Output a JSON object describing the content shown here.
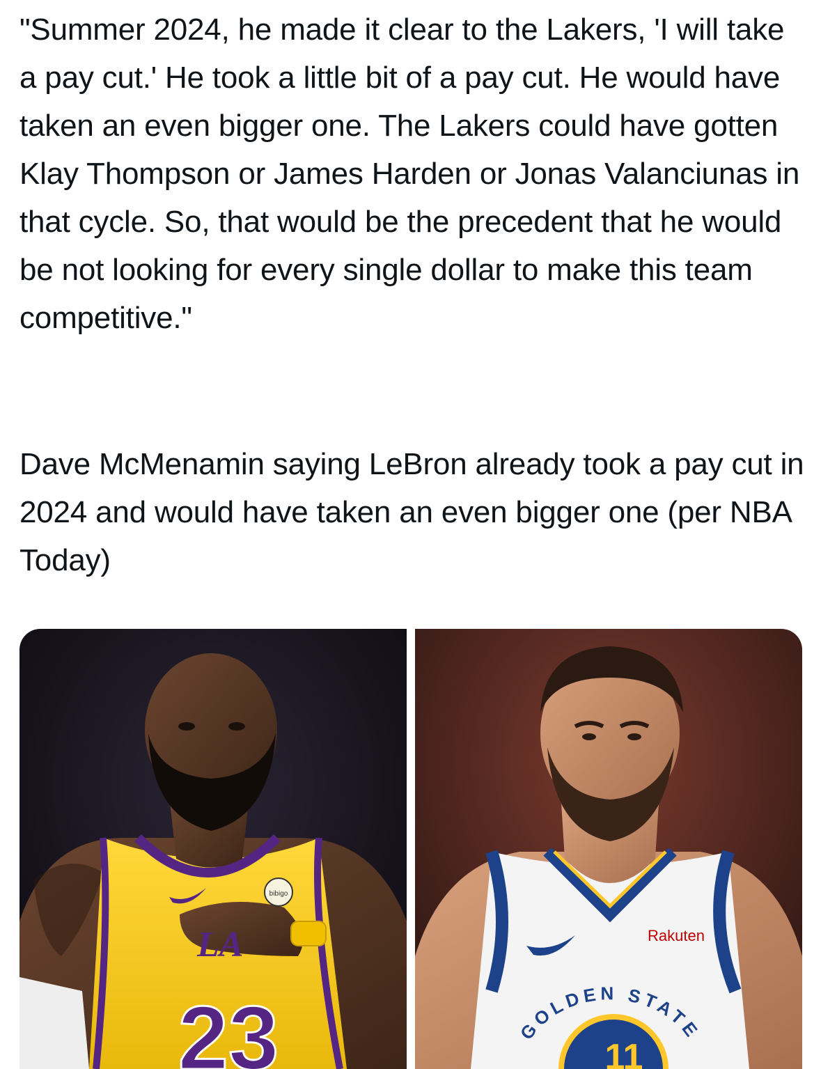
{
  "tweet": {
    "quote_text": "\"Summer 2024, he made it clear to the Lakers, 'I will take a pay cut.' He took a little bit of a pay cut. He would have taken an even bigger one. The Lakers could have gotten Klay Thompson or James Harden or Jonas Valanciunas in that cycle. So, that would be the precedent that he would be not looking for every single dollar to make this team competitive.\"",
    "caption_text": "Dave McMenamin saying LeBron already took a pay cut in 2024 and would have taken an even bigger one (per NBA Today)"
  },
  "media": {
    "left_image": {
      "jersey_sponsor": "bibigo",
      "jersey_number": "23",
      "jersey_text": "LA"
    },
    "right_image": {
      "jersey_sponsor": "Rakuten",
      "jersey_wordmark": "GOLDEN STATE",
      "jersey_number": "11"
    }
  }
}
